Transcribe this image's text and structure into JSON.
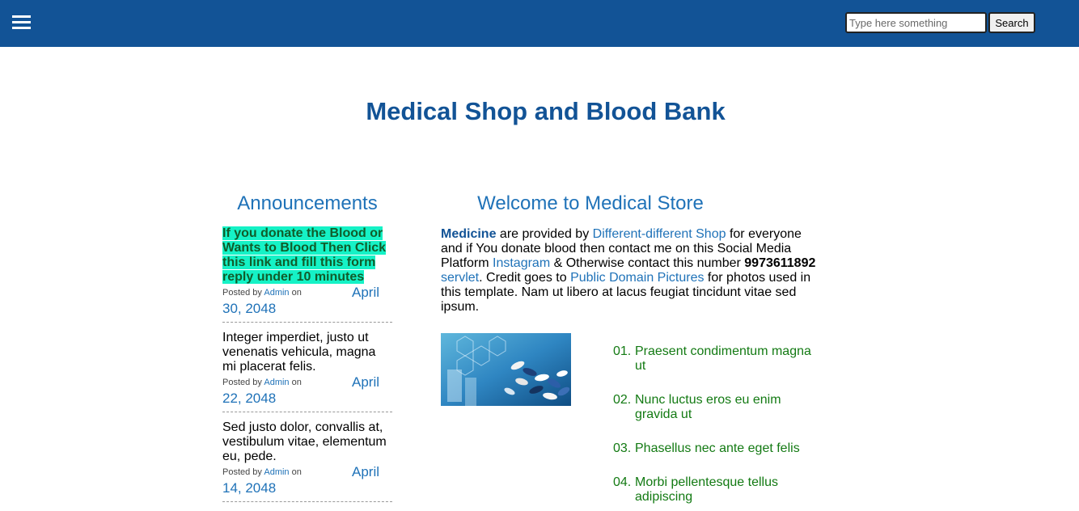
{
  "header": {
    "search_placeholder": "Type here something",
    "search_label": "Search"
  },
  "title": "Medical Shop and Blood Bank",
  "announcements": {
    "heading": "Announcements",
    "items": [
      {
        "text": "If you donate the Blood or Wants to Blood Then Click this link and fill this form reply under 10 minutes",
        "posted_prefix": "Posted by",
        "author": "Admin",
        "posted_suffix": "on",
        "month": "April",
        "rest": "30, 2048"
      },
      {
        "text": "Integer imperdiet, justo ut venenatis vehicula, magna mi placerat felis.",
        "posted_prefix": "Posted by",
        "author": "Admin",
        "posted_suffix": "on",
        "month": "April",
        "rest": "22, 2048"
      },
      {
        "text": "Sed justo dolor, convallis at, vestibulum vitae, elementum eu, pede.",
        "posted_prefix": "Posted by",
        "author": "Admin",
        "posted_suffix": "on",
        "month": "April",
        "rest": "14, 2048"
      }
    ]
  },
  "welcome": {
    "heading": "Welcome to Medical Store",
    "medicine": "Medicine",
    "t1": " are provided by ",
    "shop_link": "Different-different Shop",
    "t2": " for everyone and if You donate blood then contact me on this Social Media Platform ",
    "instagram_link": "Instagram",
    "t3": " & Otherwise contact this number ",
    "phone": "9973611892",
    "servlet_link": "servlet",
    "t4": ". Credit goes to ",
    "pdp_link": "Public Domain Pictures",
    "t5": " for photos used in this template. Nam ut libero at lacus feugiat tincidunt vitae sed ipsum."
  },
  "list": [
    {
      "num": "01.",
      "text": "Praesent condimentum magna ut"
    },
    {
      "num": "02.",
      "text": "Nunc luctus eros eu enim gravida ut"
    },
    {
      "num": "03.",
      "text": "Phasellus nec ante eget felis"
    },
    {
      "num": "04.",
      "text": "Morbi pellentesque tellus adipiscing"
    }
  ],
  "colors": {
    "header_bg": "#125396",
    "heading_blue": "#1f72b8",
    "highlight_bg": "#15f2c6",
    "list_green": "#137a13"
  },
  "icons": [
    "hamburger-menu-icon"
  ]
}
